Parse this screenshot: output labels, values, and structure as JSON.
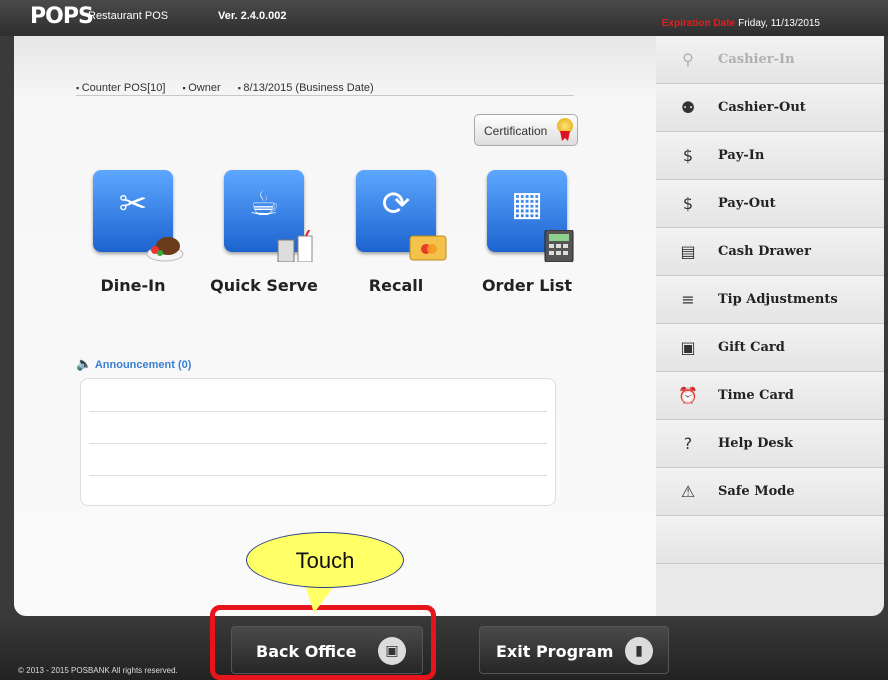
{
  "header": {
    "logo": "POPS",
    "logo_sub": "Restaurant POS",
    "version": "Ver. 2.4.0.002",
    "expiration_label": "Expiration Date",
    "expiration_value": "Friday, 11/13/2015"
  },
  "info": {
    "terminal": "Counter POS[10]",
    "user": "Owner",
    "business_date": "8/13/2015 (Business Date)"
  },
  "certification_label": "Certification",
  "tiles": [
    {
      "label": "Dine-In",
      "icon": "fork-knife-icon"
    },
    {
      "label": "Quick Serve",
      "icon": "takeout-cup-icon"
    },
    {
      "label": "Recall",
      "icon": "refresh-icon"
    },
    {
      "label": "Order List",
      "icon": "calculator-icon"
    }
  ],
  "announcement": {
    "title": "Announcement (0)"
  },
  "sidebar": {
    "items": [
      {
        "label": "Cashier-In",
        "icon": "cashier-in-icon",
        "disabled": true
      },
      {
        "label": "Cashier-Out",
        "icon": "cashier-out-icon"
      },
      {
        "label": "Pay-In",
        "icon": "pay-in-icon"
      },
      {
        "label": "Pay-Out",
        "icon": "pay-out-icon"
      },
      {
        "label": "Cash Drawer",
        "icon": "cash-drawer-icon"
      },
      {
        "label": "Tip Adjustments",
        "icon": "tip-adjustments-icon"
      },
      {
        "label": "Gift Card",
        "icon": "gift-card-icon"
      },
      {
        "label": "Time Card",
        "icon": "alarm-clock-icon"
      },
      {
        "label": "Help Desk",
        "icon": "help-icon"
      },
      {
        "label": "Safe Mode",
        "icon": "siren-icon"
      }
    ]
  },
  "footer": {
    "copyright": "© 2013 - 2015 POSBANK All rights reserved.",
    "back_office": "Back Office",
    "exit_program": "Exit Program"
  },
  "callout": {
    "text": "Touch"
  },
  "colors": {
    "accent": "#1c63cf",
    "highlight": "#e8141b",
    "callout": "#ffff66"
  }
}
